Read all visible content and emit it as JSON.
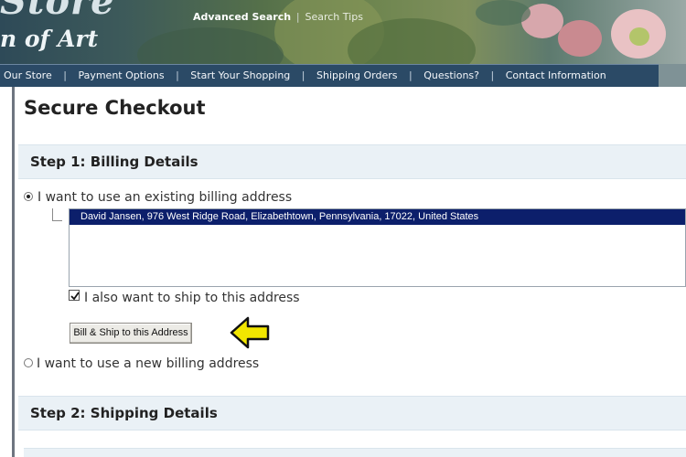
{
  "banner": {
    "logo_line_top": "Store",
    "logo_line_bottom": "n of Art",
    "advanced_search": "Advanced Search",
    "separator": "|",
    "search_tips": "Search Tips"
  },
  "nav": {
    "separator": "|",
    "items": [
      {
        "label": "Our Store"
      },
      {
        "label": "Payment Options"
      },
      {
        "label": "Start Your Shopping"
      },
      {
        "label": "Shipping Orders"
      },
      {
        "label": "Questions?"
      },
      {
        "label": "Contact Information"
      }
    ]
  },
  "page": {
    "title": "Secure Checkout"
  },
  "checkout": {
    "step1_title": "Step 1: Billing Details",
    "existing_address_label": "I want to use an existing billing address",
    "existing_address_selected": true,
    "address_option": "David Jansen, 976 West Ridge Road, Elizabethtown, Pennsylvania, 17022, United States",
    "ship_to_same_label": "I also want to ship to this address",
    "ship_to_same_checked": true,
    "bill_ship_button": "Bill & Ship to this Address",
    "new_address_label": "I want to use a new billing address",
    "new_address_selected": false,
    "step2_title": "Step 2: Shipping Details"
  },
  "annotation": {
    "arrow_icon": "arrow-left-icon",
    "arrow_color": "#f2e600"
  },
  "colors": {
    "nav_background": "#2b4a66",
    "step_header_background": "#eaf1f6",
    "selection_highlight": "#0c1f6b"
  }
}
